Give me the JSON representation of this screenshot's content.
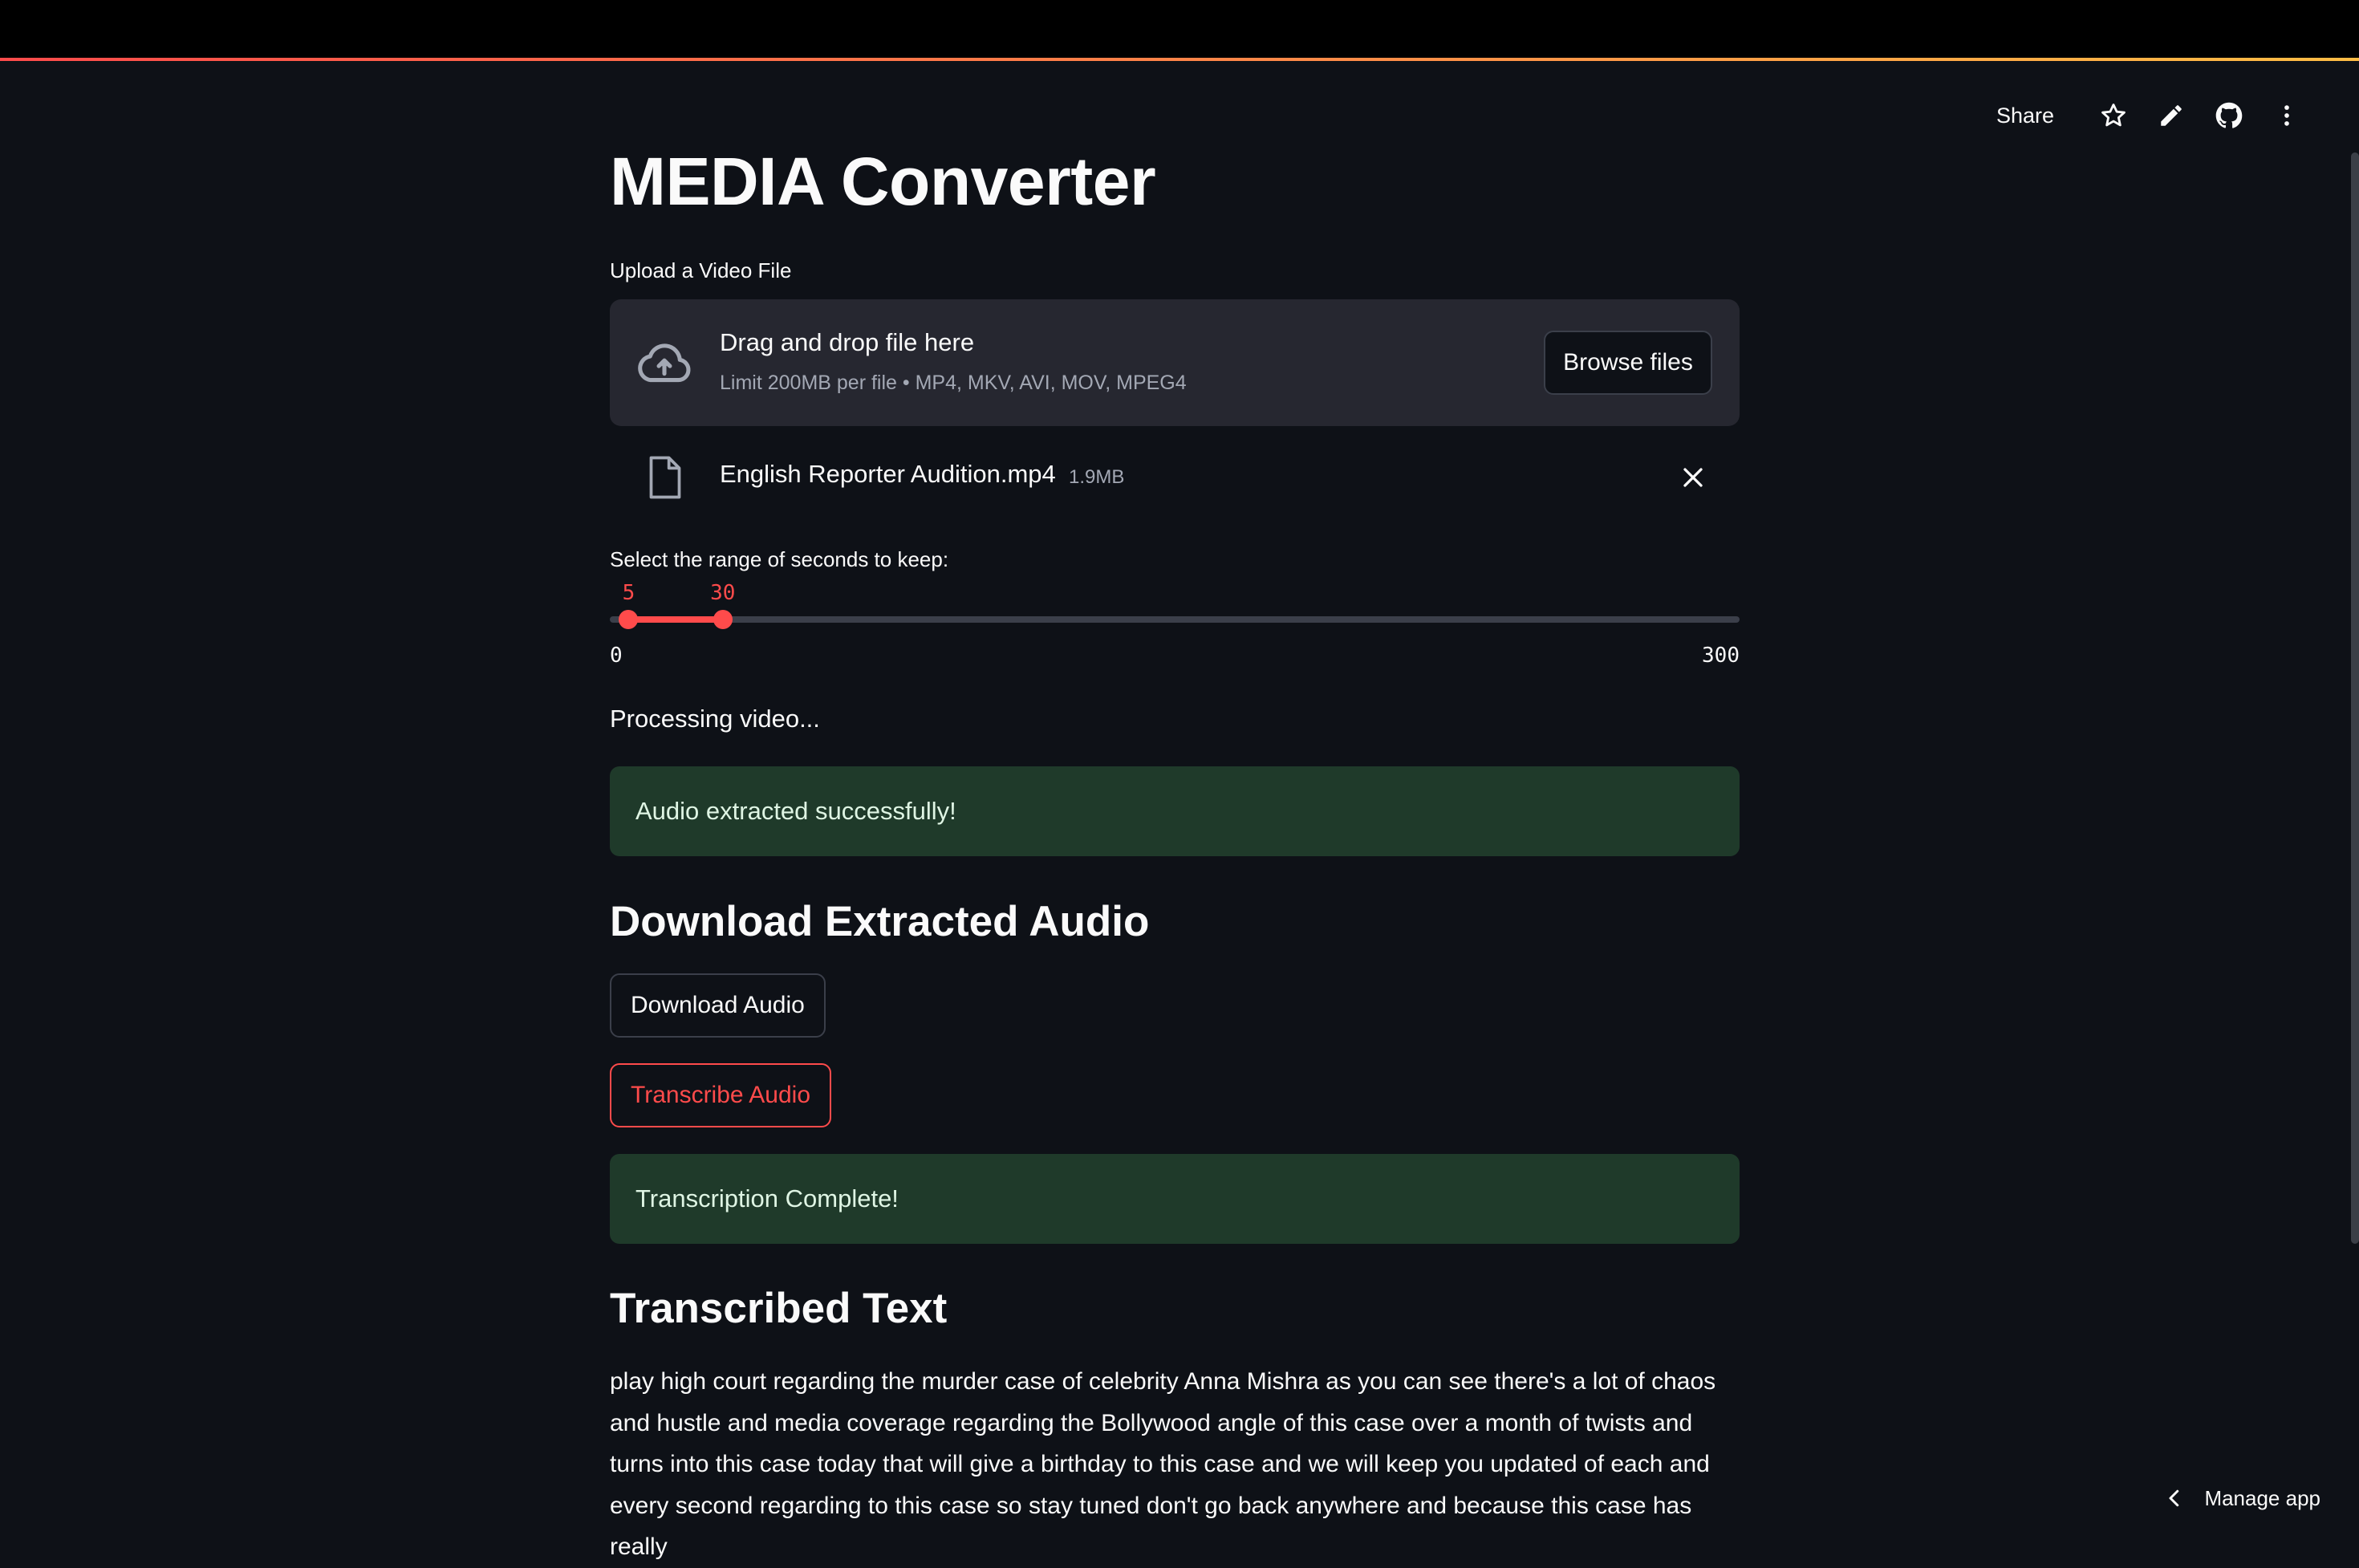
{
  "toolbar": {
    "share_label": "Share",
    "icons": [
      "star-icon",
      "pencil-icon",
      "github-icon",
      "more-vertical-icon"
    ]
  },
  "app": {
    "title": "MEDIA Converter"
  },
  "uploader": {
    "label": "Upload a Video File",
    "dropzone_title": "Drag and drop file here",
    "dropzone_hint": "Limit 200MB per file • MP4, MKV, AVI, MOV, MPEG4",
    "browse_label": "Browse files",
    "file": {
      "name": "English Reporter Audition.mp4",
      "size": "1.9MB"
    }
  },
  "range_slider": {
    "label": "Select the range of seconds to keep:",
    "min": 0,
    "max": 300,
    "low": 5,
    "high": 30,
    "min_label": "0",
    "max_label": "300",
    "low_label": "5",
    "high_label": "30",
    "accent": "#ff4b4b"
  },
  "status": {
    "processing": "Processing video...",
    "audio_success": "Audio extracted successfully!",
    "transcription_success": "Transcription Complete!",
    "success_bg": "#1f3a2a"
  },
  "download_section": {
    "heading": "Download Extracted Audio",
    "download_label": "Download Audio",
    "transcribe_label": "Transcribe Audio"
  },
  "transcription": {
    "heading": "Transcribed Text",
    "lines": [
      "play high court regarding the murder case of celebrity Anna Mishra as you can see there's a lot of chaos",
      "and hustle and media coverage regarding the Bollywood angle of this case over a month of twists and",
      "turns into this case today that will give a birthday to this case and we will keep you updated of each and",
      "every second regarding to this case so stay tuned don't go back anywhere and because this case has really"
    ]
  },
  "footer": {
    "manage_label": "Manage app"
  }
}
